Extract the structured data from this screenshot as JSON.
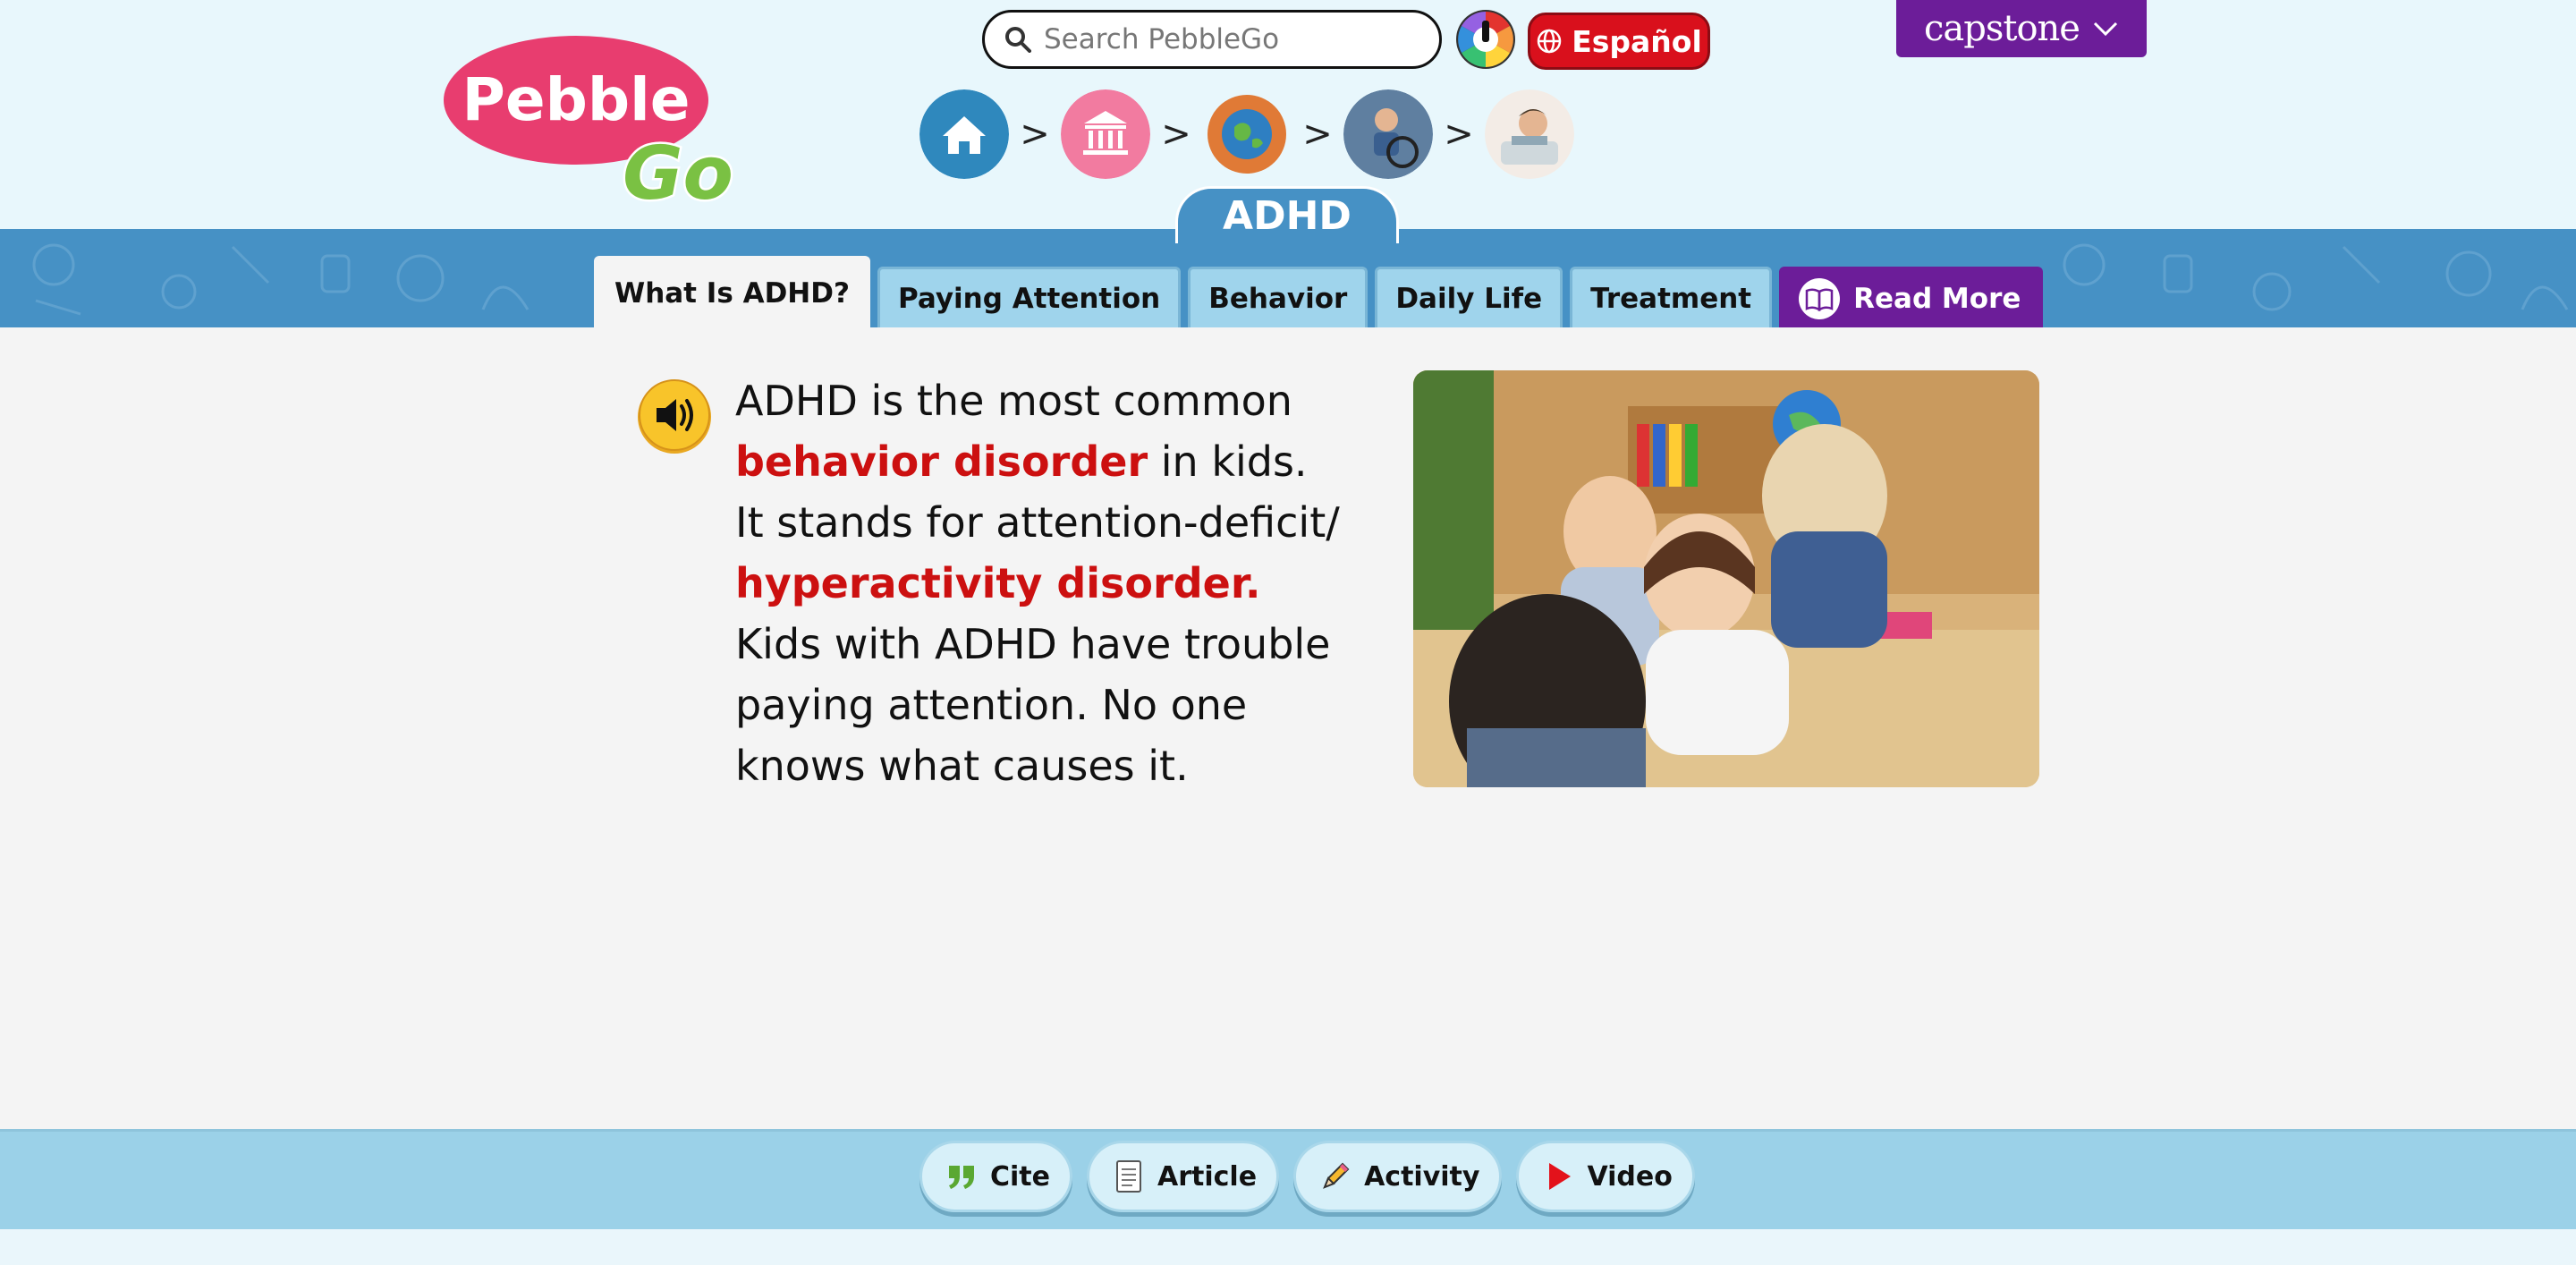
{
  "header": {
    "logo": {
      "word1": "Pebble",
      "word2": "Go"
    },
    "search": {
      "placeholder": "Search PebbleGo"
    },
    "language_button": "Español",
    "brand_menu": "capstone",
    "breadcrumbs": [
      {
        "icon": "home-icon"
      },
      {
        "icon": "social-studies-icon"
      },
      {
        "icon": "world-icon"
      },
      {
        "icon": "people-icon"
      },
      {
        "icon": "adhd-topic-icon"
      }
    ]
  },
  "page": {
    "title": "ADHD"
  },
  "tabs": [
    {
      "label": "What Is ADHD?",
      "active": true
    },
    {
      "label": "Paying Attention"
    },
    {
      "label": "Behavior"
    },
    {
      "label": "Daily Life"
    },
    {
      "label": "Treatment"
    },
    {
      "label": "Read More",
      "icon": "book-icon"
    }
  ],
  "article": {
    "lines": [
      "ADHD is the most common",
      "behavior disorder",
      " in kids.",
      "It stands for attention-deficit/",
      "hyperactivity disorder.",
      "Kids with ADHD have trouble",
      "paying attention. No one",
      "knows what causes it."
    ]
  },
  "footer": {
    "buttons": [
      {
        "label": "Cite",
        "icon": "quote-icon"
      },
      {
        "label": "Article",
        "icon": "document-icon"
      },
      {
        "label": "Activity",
        "icon": "pencil-icon"
      },
      {
        "label": "Video",
        "icon": "play-icon"
      }
    ]
  },
  "colors": {
    "header_bg": "#e8f7fc",
    "band": "#4691c5",
    "tab": "#9fd4ec",
    "read_more": "#6c1d99",
    "term_red": "#cc1010",
    "spanish_red": "#d9101c",
    "footer": "#9bd1e8"
  }
}
